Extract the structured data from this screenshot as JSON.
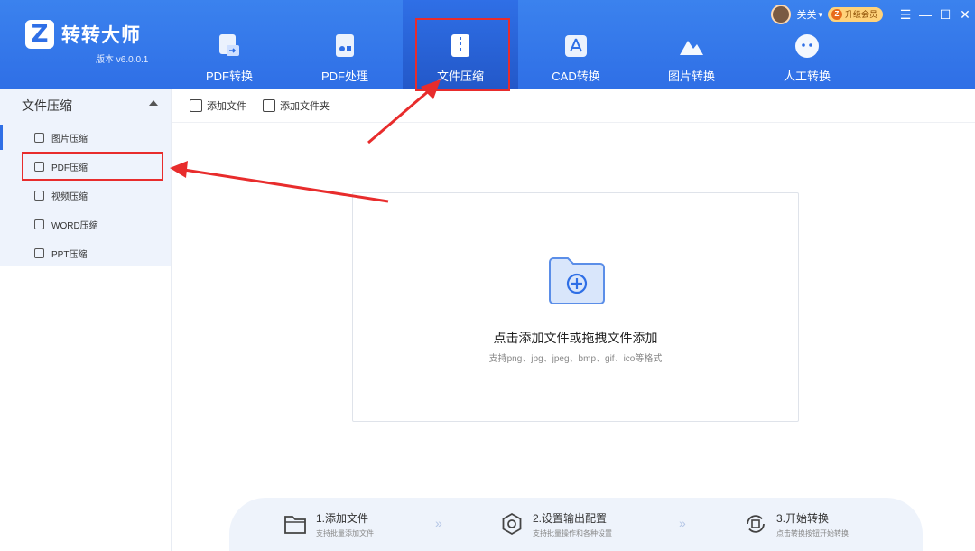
{
  "app": {
    "name": "转转大师",
    "version": "版本 v6.0.0.1"
  },
  "nav": {
    "tabs": [
      {
        "label": "PDF转换",
        "icon": "pdf-convert-icon"
      },
      {
        "label": "PDF处理",
        "icon": "pdf-process-icon"
      },
      {
        "label": "文件压缩",
        "icon": "file-compress-icon",
        "active": true
      },
      {
        "label": "CAD转换",
        "icon": "cad-icon"
      },
      {
        "label": "图片转换",
        "icon": "image-convert-icon"
      },
      {
        "label": "人工转换",
        "icon": "manual-convert-icon"
      }
    ]
  },
  "user": {
    "name": "关关",
    "vip_label": "升级会员"
  },
  "sidebar": {
    "section_title": "文件压缩",
    "items": [
      {
        "label": "图片压缩",
        "icon": "image-icon"
      },
      {
        "label": "PDF压缩",
        "icon": "pdf-icon",
        "highlighted": true
      },
      {
        "label": "视频压缩",
        "icon": "video-icon"
      },
      {
        "label": "WORD压缩",
        "icon": "word-icon"
      },
      {
        "label": "PPT压缩",
        "icon": "ppt-icon"
      }
    ]
  },
  "toolbar": {
    "add_file": "添加文件",
    "add_folder": "添加文件夹"
  },
  "dropzone": {
    "title": "点击添加文件或拖拽文件添加",
    "subtitle": "支持png、jpg、jpeg、bmp、gif、ico等格式"
  },
  "steps": [
    {
      "title": "1.添加文件",
      "subtitle": "支持批量添加文件"
    },
    {
      "title": "2.设置输出配置",
      "subtitle": "支持批量操作和各种设置"
    },
    {
      "title": "3.开始转换",
      "subtitle": "点击转换按钮开始转换"
    }
  ],
  "colors": {
    "header": "#2f6fe6",
    "accent": "#2f6fe6",
    "annotation": "#e82c2c",
    "sidebar_bg": "#eef3fc"
  }
}
